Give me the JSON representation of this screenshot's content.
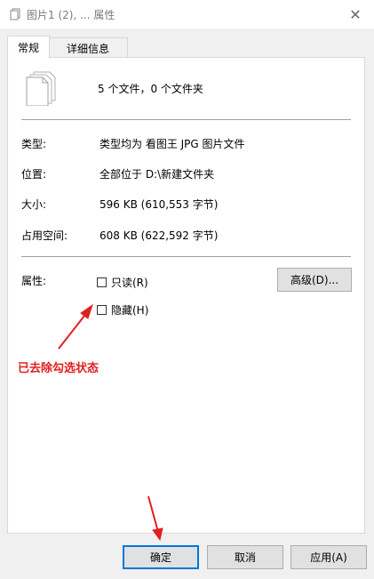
{
  "window": {
    "title": "图片1 (2), ... 属性",
    "close_icon": "close-icon"
  },
  "tabs": [
    {
      "label": "常规",
      "active": true
    },
    {
      "label": "详细信息",
      "active": false
    }
  ],
  "general": {
    "summary": "5 个文件，0 个文件夹",
    "rows": [
      {
        "label": "类型:",
        "value": "类型均为 看图王 JPG 图片文件"
      },
      {
        "label": "位置:",
        "value": "全部位于 D:\\新建文件夹"
      },
      {
        "label": "大小:",
        "value": "596 KB (610,553 字节)"
      },
      {
        "label": "占用空间:",
        "value": "608 KB (622,592 字节)"
      }
    ],
    "attributes_label": "属性:",
    "readonly": {
      "label": "只读(R)",
      "checked": false
    },
    "hidden": {
      "label": "隐藏(H)",
      "checked": false
    },
    "advanced_button": "高级(D)..."
  },
  "annotation": {
    "text": "已去除勾选状态",
    "color": "#e02020"
  },
  "footer": {
    "ok": "确定",
    "cancel": "取消",
    "apply": "应用(A)"
  }
}
